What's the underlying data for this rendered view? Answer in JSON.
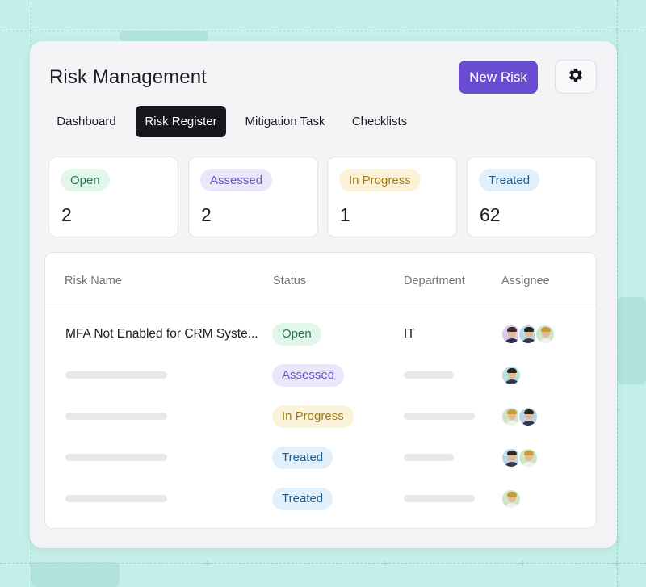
{
  "app": {
    "title": "Risk Management",
    "new_risk_label": "New Risk",
    "settings_icon": "gear-icon"
  },
  "tabs": [
    {
      "label": "Dashboard",
      "active": false
    },
    {
      "label": "Risk Register",
      "active": true
    },
    {
      "label": "Mitigation Task",
      "active": false
    },
    {
      "label": "Checklists",
      "active": false
    }
  ],
  "stats": [
    {
      "label": "Open",
      "value": "2",
      "variant": "open"
    },
    {
      "label": "Assessed",
      "value": "2",
      "variant": "assessed"
    },
    {
      "label": "In Progress",
      "value": "1",
      "variant": "progress"
    },
    {
      "label": "Treated",
      "value": "62",
      "variant": "treated"
    }
  ],
  "table": {
    "headers": {
      "risk_name": "Risk Name",
      "status": "Status",
      "department": "Department",
      "assignee": "Assignee"
    },
    "rows": [
      {
        "name": "MFA Not Enabled for CRM Syste...",
        "status": "Open",
        "variant": "open",
        "department": "IT",
        "assignees": [
          "avatar-purple",
          "avatar-man-dark",
          "avatar-woman-blonde"
        ]
      },
      {
        "name": "",
        "status": "Assessed",
        "variant": "assessed",
        "department": "",
        "assignees": [
          "avatar-man-teal"
        ]
      },
      {
        "name": "",
        "status": "In Progress",
        "variant": "progress",
        "department": "",
        "assignees": [
          "avatar-woman-blonde",
          "avatar-man-dark"
        ]
      },
      {
        "name": "",
        "status": "Treated",
        "variant": "treated",
        "department": "",
        "assignees": [
          "avatar-man-dark",
          "avatar-woman-blonde"
        ]
      },
      {
        "name": "",
        "status": "Treated",
        "variant": "treated",
        "department": "",
        "assignees": [
          "avatar-woman-blonde"
        ]
      }
    ]
  },
  "colors": {
    "primary": "#6a4cd1",
    "tab_active": "#16181d",
    "background": "#c7efe9"
  }
}
